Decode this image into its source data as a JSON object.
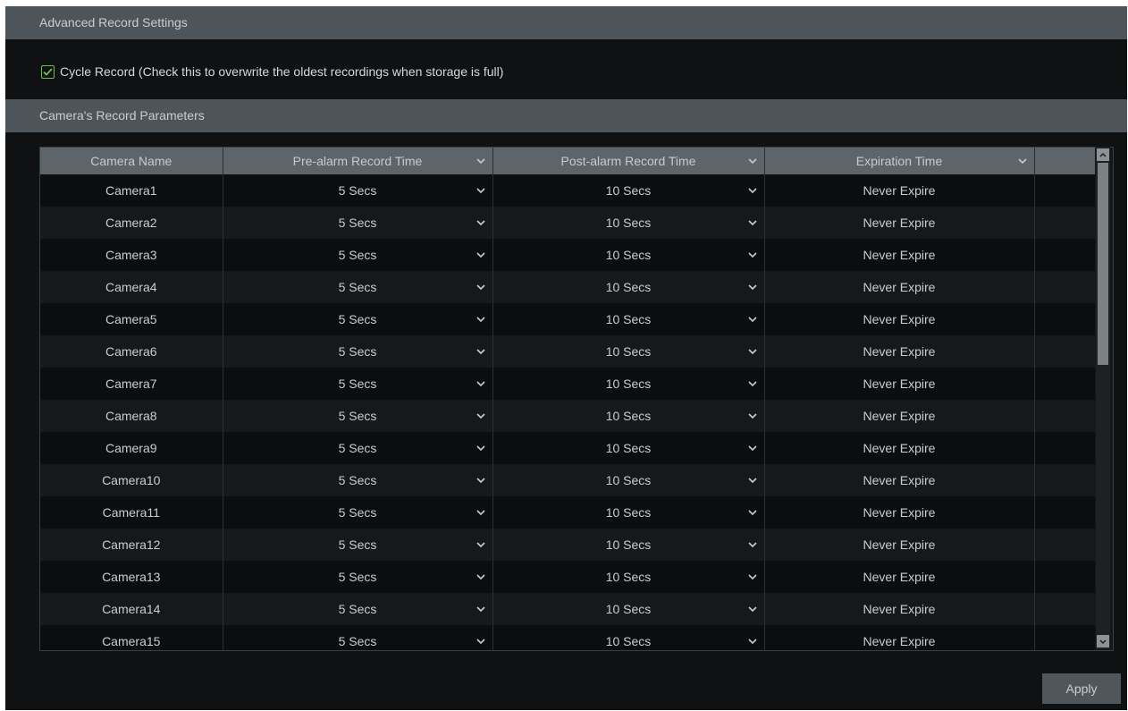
{
  "sections": {
    "advanced_title": "Advanced Record Settings",
    "params_title": "Camera's Record Parameters"
  },
  "cycle_record": {
    "checked": true,
    "label": "Cycle Record (Check this to overwrite the oldest recordings when storage is full)"
  },
  "table": {
    "columns": [
      "Camera Name",
      "Pre-alarm Record Time",
      "Post-alarm Record Time",
      "Expiration Time"
    ],
    "rows": [
      {
        "camera": "Camera1",
        "pre": "5 Secs",
        "post": "10 Secs",
        "expire": "Never Expire"
      },
      {
        "camera": "Camera2",
        "pre": "5 Secs",
        "post": "10 Secs",
        "expire": "Never Expire"
      },
      {
        "camera": "Camera3",
        "pre": "5 Secs",
        "post": "10 Secs",
        "expire": "Never Expire"
      },
      {
        "camera": "Camera4",
        "pre": "5 Secs",
        "post": "10 Secs",
        "expire": "Never Expire"
      },
      {
        "camera": "Camera5",
        "pre": "5 Secs",
        "post": "10 Secs",
        "expire": "Never Expire"
      },
      {
        "camera": "Camera6",
        "pre": "5 Secs",
        "post": "10 Secs",
        "expire": "Never Expire"
      },
      {
        "camera": "Camera7",
        "pre": "5 Secs",
        "post": "10 Secs",
        "expire": "Never Expire"
      },
      {
        "camera": "Camera8",
        "pre": "5 Secs",
        "post": "10 Secs",
        "expire": "Never Expire"
      },
      {
        "camera": "Camera9",
        "pre": "5 Secs",
        "post": "10 Secs",
        "expire": "Never Expire"
      },
      {
        "camera": "Camera10",
        "pre": "5 Secs",
        "post": "10 Secs",
        "expire": "Never Expire"
      },
      {
        "camera": "Camera11",
        "pre": "5 Secs",
        "post": "10 Secs",
        "expire": "Never Expire"
      },
      {
        "camera": "Camera12",
        "pre": "5 Secs",
        "post": "10 Secs",
        "expire": "Never Expire"
      },
      {
        "camera": "Camera13",
        "pre": "5 Secs",
        "post": "10 Secs",
        "expire": "Never Expire"
      },
      {
        "camera": "Camera14",
        "pre": "5 Secs",
        "post": "10 Secs",
        "expire": "Never Expire"
      },
      {
        "camera": "Camera15",
        "pre": "5 Secs",
        "post": "10 Secs",
        "expire": "Never Expire"
      }
    ]
  },
  "apply_label": "Apply",
  "colors": {
    "panel_bg": "#0f1113",
    "section_bar": "#4d555b",
    "header_bg": "#5d656b",
    "checkbox_accent": "#6bbf4d"
  },
  "icons": {
    "dropdown": "chevron-down-icon",
    "check": "check-icon",
    "scroll_up": "arrow-up-icon",
    "scroll_down": "arrow-down-icon"
  }
}
